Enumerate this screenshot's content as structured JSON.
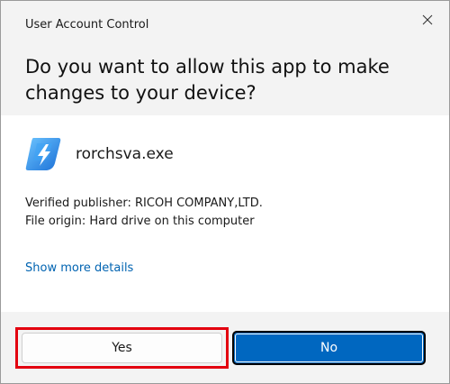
{
  "window": {
    "title": "User Account Control"
  },
  "header": {
    "question": "Do you want to allow this app to make changes to your device?"
  },
  "app": {
    "name": "rorchsva.exe",
    "icon": "app-shield-icon"
  },
  "info": {
    "publisher": "Verified publisher: RICOH COMPANY,LTD.",
    "origin": "File origin: Hard drive on this computer"
  },
  "details_link": "Show more details",
  "buttons": {
    "yes_label": "Yes",
    "no_label": "No"
  },
  "colors": {
    "accent": "#0067c0",
    "link": "#0063b1",
    "highlight": "#e3000f",
    "header_bg": "#f3f3f3"
  }
}
